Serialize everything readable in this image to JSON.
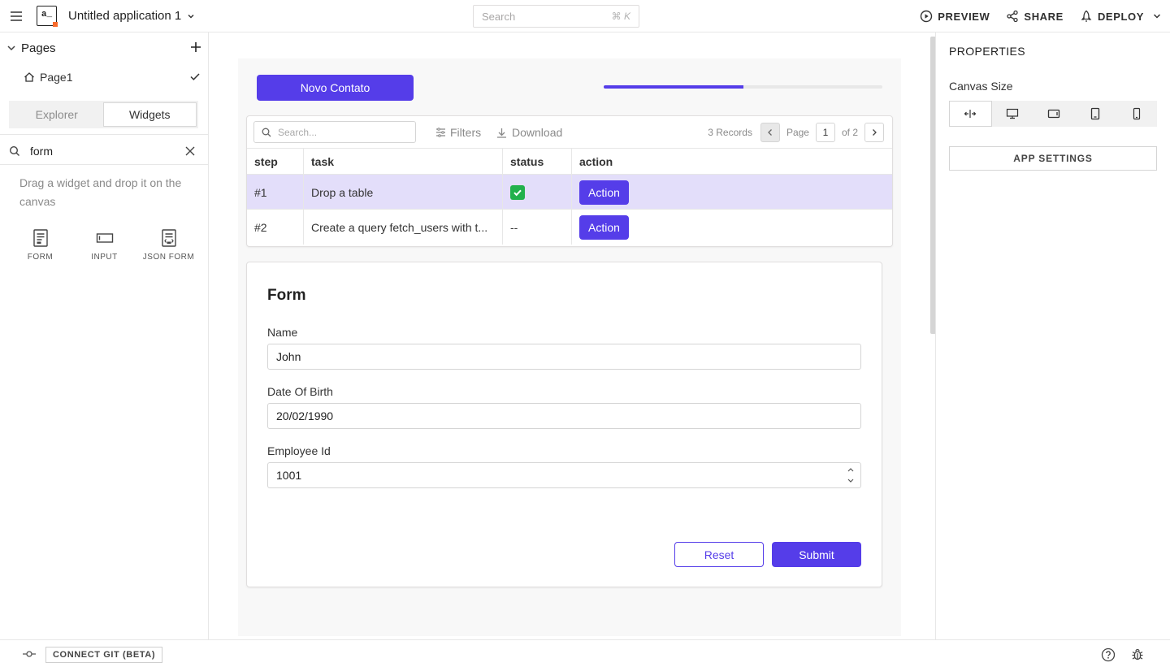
{
  "topbar": {
    "logo_text": "a_",
    "app_title": "Untitled application 1",
    "search_placeholder": "Search",
    "search_shortcut": "⌘ K",
    "preview": "PREVIEW",
    "share": "SHARE",
    "deploy": "DEPLOY"
  },
  "sidebar": {
    "pages_label": "Pages",
    "page_name": "Page1",
    "tabs": [
      "Explorer",
      "Widgets"
    ],
    "active_tab": "Widgets",
    "widget_search": "form",
    "hint": "Drag a widget and drop it on the canvas",
    "widgets": [
      {
        "icon": "form-widget-icon",
        "name": "FORM"
      },
      {
        "icon": "input-widget-icon",
        "name": "INPUT"
      },
      {
        "icon": "json-form-widget-icon",
        "name": "JSON FORM"
      }
    ]
  },
  "canvas": {
    "new_contact_button": "Novo Contato",
    "progress_percent": 50,
    "table": {
      "search_placeholder": "Search...",
      "filters": "Filters",
      "download": "Download",
      "records": "3 Records",
      "page_label": "Page",
      "page_current": "1",
      "page_total": "of 2",
      "columns": [
        "step",
        "task",
        "status",
        "action"
      ],
      "rows": [
        {
          "step": "#1",
          "task": "Drop a table",
          "status": "✅",
          "action": "Action",
          "selected": true
        },
        {
          "step": "#2",
          "task": "Create a query fetch_users with t...",
          "status": "--",
          "action": "Action",
          "selected": false
        }
      ]
    },
    "form": {
      "title": "Form",
      "name_label": "Name",
      "name_value": "John",
      "dob_label": "Date Of Birth",
      "dob_value": "20/02/1990",
      "employee_label": "Employee Id",
      "employee_value": "1001",
      "reset": "Reset",
      "submit": "Submit"
    }
  },
  "properties": {
    "title": "PROPERTIES",
    "canvas_size_label": "Canvas Size",
    "sizes": [
      "fluid-width-icon",
      "desktop-icon",
      "tablet-landscape-icon",
      "tablet-icon",
      "mobile-icon"
    ],
    "app_settings": "APP SETTINGS"
  },
  "bottombar": {
    "connect_git": "CONNECT GIT (BETA)"
  },
  "colors": {
    "accent": "#553de9",
    "selected_row": "#e3defa",
    "logo_accent": "#f86a2b"
  }
}
